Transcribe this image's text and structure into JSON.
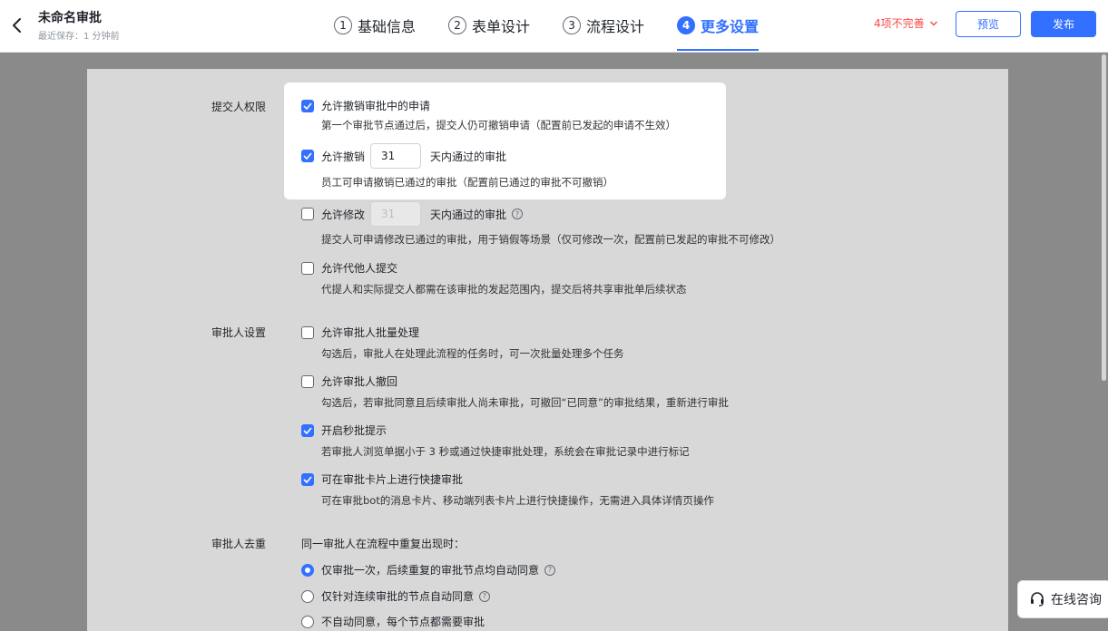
{
  "header": {
    "title": "未命名审批",
    "saved": "最近保存：1 分钟前",
    "steps": [
      {
        "num": "1",
        "label": "基础信息"
      },
      {
        "num": "2",
        "label": "表单设计"
      },
      {
        "num": "3",
        "label": "流程设计"
      },
      {
        "num": "4",
        "label": "更多设置"
      }
    ],
    "incomplete": "4项不完善",
    "preview": "预览",
    "publish": "发布"
  },
  "submitter": {
    "label": "提交人权限",
    "revoke_pending": {
      "label": "允许撤销审批中的申请",
      "desc": "第一个审批节点通过后，提交人仍可撤销申请（配置前已发起的申请不生效）"
    },
    "revoke_approved": {
      "prefix": "允许撤销",
      "days": "31",
      "suffix": "天内通过的审批",
      "desc": "员工可申请撤销已通过的审批（配置前已通过的审批不可撤销）"
    },
    "modify_approved": {
      "prefix": "允许修改",
      "days": "31",
      "suffix": "天内通过的审批",
      "desc": "提交人可申请修改已通过的审批，用于销假等场景（仅可修改一次，配置前已发起的审批不可修改）"
    },
    "proxy_submit": {
      "label": "允许代他人提交",
      "desc": "代提人和实际提交人都需在该审批的发起范围内，提交后将共享审批单后续状态"
    }
  },
  "approver": {
    "label": "审批人设置",
    "batch": {
      "label": "允许审批人批量处理",
      "desc": "勾选后，审批人在处理此流程的任务时，可一次批量处理多个任务"
    },
    "withdraw": {
      "label": "允许审批人撤回",
      "desc": "勾选后，若审批同意且后续审批人尚未审批，可撤回“已同意”的审批结果，重新进行审批"
    },
    "instant": {
      "label": "开启秒批提示",
      "desc": "若审批人浏览单据小于 3 秒或通过快捷审批处理，系统会在审批记录中进行标记"
    },
    "quick_card": {
      "label": "可在审批卡片上进行快捷审批",
      "desc": "可在审批bot的消息卡片、移动端列表卡片上进行快捷操作，无需进入具体详情页操作"
    }
  },
  "dedupe": {
    "label": "审批人去重",
    "intro": "同一审批人在流程中重复出现时：",
    "options": [
      "仅审批一次，后续重复的审批节点均自动同意",
      "仅针对连续审批的节点自动同意",
      "不自动同意，每个节点都需要审批"
    ]
  },
  "consult": "在线咨询",
  "icons": {
    "help": "?"
  },
  "colors": {
    "accent": "#3370ff",
    "warning": "#f54a45"
  }
}
